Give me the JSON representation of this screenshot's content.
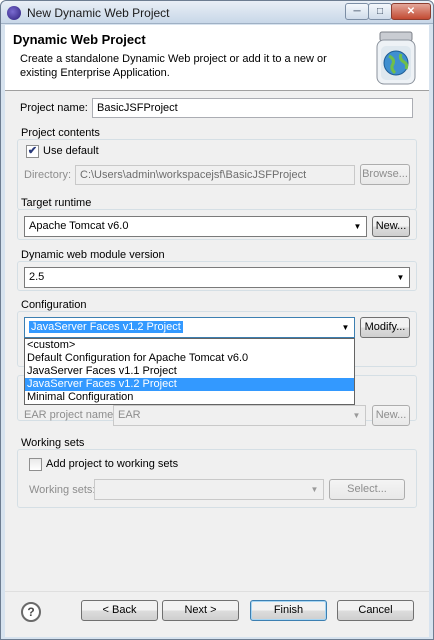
{
  "window": {
    "title": "New Dynamic Web Project",
    "minimize_glyph": "─",
    "maximize_glyph": "□",
    "close_glyph": "✕"
  },
  "header": {
    "title": "Dynamic Web Project",
    "description": "Create a standalone Dynamic Web project or add it to a new or existing Enterprise Application."
  },
  "project_name": {
    "label": "Project name:",
    "value": "BasicJSFProject"
  },
  "project_contents": {
    "group_label": "Project contents",
    "use_default_label": "Use default",
    "use_default_checked": true,
    "directory_label": "Directory:",
    "directory_value": "C:\\Users\\admin\\workspacejsf\\BasicJSFProject",
    "browse_label": "Browse..."
  },
  "target_runtime": {
    "group_label": "Target runtime",
    "value": "Apache Tomcat v6.0",
    "new_label": "New..."
  },
  "module_version": {
    "group_label": "Dynamic web module version",
    "value": "2.5"
  },
  "configuration": {
    "group_label": "Configuration",
    "value": "JavaServer Faces v1.2 Project",
    "modify_label": "Modify...",
    "options": [
      "<custom>",
      "Default Configuration for Apache Tomcat v6.0",
      "JavaServer Faces v1.1 Project",
      "JavaServer Faces v1.2 Project",
      "Minimal Configuration"
    ],
    "selected_index": 3
  },
  "ear": {
    "project_name_label": "EAR project name:",
    "value": "EAR",
    "new_label": "New..."
  },
  "working_sets": {
    "group_label": "Working sets",
    "add_label": "Add project to working sets",
    "add_checked": false,
    "sets_label": "Working sets:",
    "sets_value": "",
    "select_label": "Select..."
  },
  "footer": {
    "help_glyph": "?",
    "back_label": "< Back",
    "next_label": "Next >",
    "finish_label": "Finish",
    "cancel_label": "Cancel"
  },
  "icons": {
    "title_icon": "eclipse-icon",
    "header_icon": "web-project-jar-icon",
    "help_icon": "help-icon"
  },
  "colors": {
    "selection": "#3399ff",
    "window_frame": "#d7e3ef"
  }
}
